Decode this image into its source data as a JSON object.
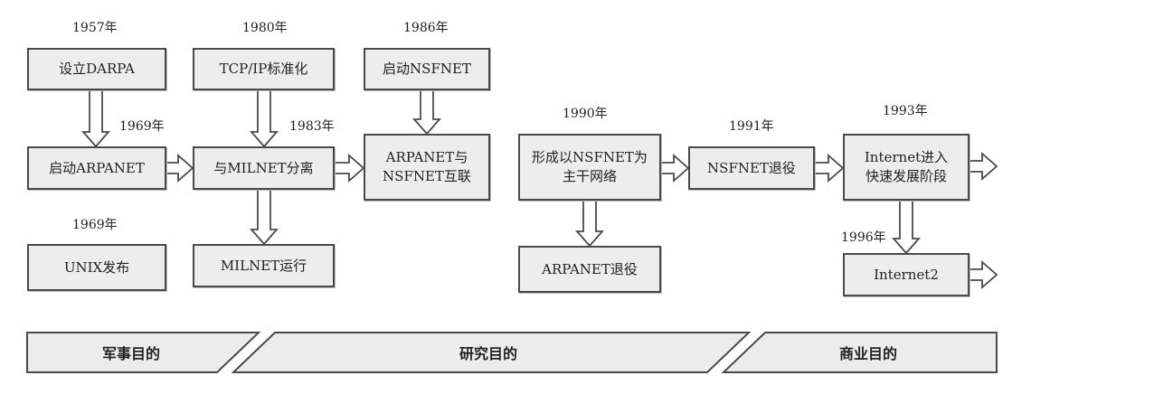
{
  "years": {
    "y1957": "1957年",
    "y1980": "1980年",
    "y1986": "1986年",
    "y1969a": "1969年",
    "y1983": "1983年",
    "y1990": "1990年",
    "y1991": "1991年",
    "y1993": "1993年",
    "y1969b": "1969年",
    "y1996": "1996年"
  },
  "boxes": {
    "darpa": "设立DARPA",
    "tcpip": "TCP/IP标准化",
    "nsfnet_start": "启动NSFNET",
    "arpanet_start": "启动ARPANET",
    "milnet_split": "与MILNET分离",
    "arpanet_nsfnet": "ARPANET与\nNSFNET互联",
    "nsfnet_backbone": "形成以NSFNET为\n主干网络",
    "nsfnet_retire": "NSFNET退役",
    "internet_fast": "Internet进入\n快速发展阶段",
    "unix": "UNIX发布",
    "milnet_run": "MILNET运行",
    "arpanet_retire": "ARPANET退役",
    "internet2": "Internet2"
  },
  "phases": {
    "military": "军事目的",
    "research": "研究目的",
    "commercial": "商业目的"
  }
}
